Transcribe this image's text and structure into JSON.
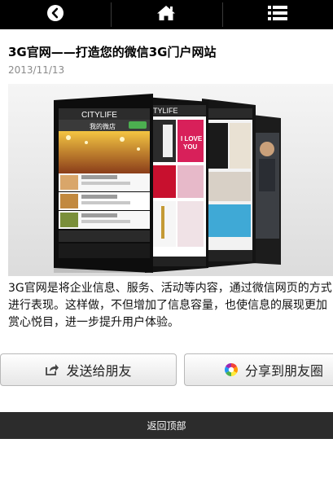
{
  "nav": {
    "back_icon": "circle-chevron-left-icon",
    "home_icon": "home-icon",
    "menu_icon": "list-menu-icon"
  },
  "article": {
    "title": "3G官网——打造您的微信3G门户网站",
    "date": "2013/11/13",
    "hero_image": {
      "app_name": "CITYLIFE",
      "screen_title": "我的微店",
      "banner_text": "I LOVE YOU"
    },
    "body": "3G官网是将企业信息、服务、活动等内容，通过微信网页的方式进行表现。这样做，不但增加了信息容量，也使信息的展现更加赏心悦目，进一步提升用户体验。"
  },
  "share": {
    "send_friend_label": "发送给朋友",
    "send_friend_icon": "share-arrow-icon",
    "timeline_label": "分享到朋友圈",
    "timeline_icon": "moments-color-wheel-icon"
  },
  "footer": {
    "back_to_top": "返回顶部"
  },
  "colors": {
    "topbar": "#000000",
    "footer": "#2c2c2c",
    "date_text": "#8a8a8a"
  }
}
